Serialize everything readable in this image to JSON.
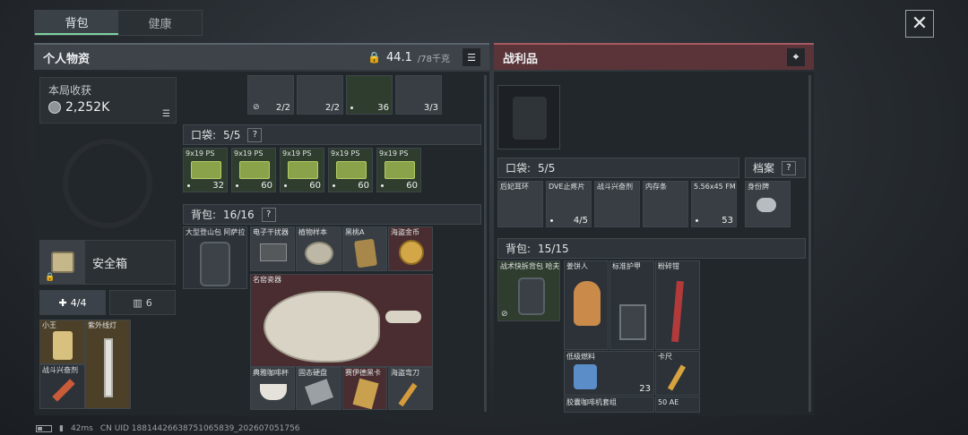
{
  "tabs": {
    "backpack": "背包",
    "health": "健康"
  },
  "left": {
    "title": "个人物资",
    "weight_current": "44.1",
    "weight_max": "/78千克"
  },
  "right": {
    "title": "战利品"
  },
  "harvest": {
    "label": "本局收获",
    "value": "2,252K"
  },
  "safe": {
    "label": "安全箱"
  },
  "subtabs": {
    "a": "4/4",
    "b": "6"
  },
  "pocket_left": {
    "label": "口袋:",
    "count": "5/5"
  },
  "backpack_left": {
    "label": "背包:",
    "count": "16/16"
  },
  "pocket_right": {
    "label": "口袋:",
    "count": "5/5"
  },
  "backpack_right": {
    "label": "背包:",
    "count": "15/15"
  },
  "archive": {
    "label": "档案"
  },
  "top_items": [
    {
      "count": "2/2"
    },
    {
      "count": "2/2"
    },
    {
      "count": "36"
    },
    {
      "count": "3/3"
    }
  ],
  "pocket_items_left": [
    {
      "name": "9x19 PS",
      "count": "32"
    },
    {
      "name": "9x19 PS",
      "count": "60"
    },
    {
      "name": "9x19 PS",
      "count": "60"
    },
    {
      "name": "9x19 PS",
      "count": "60"
    },
    {
      "name": "9x19 PS",
      "count": "60"
    }
  ],
  "backpack_items_left": {
    "bag": "大型登山包 阿萨拉",
    "jammer": "电子干扰器",
    "plant": "植物样本",
    "peach": "黑桃A",
    "coin": "海盗金币",
    "porcelain": "名窑瓷器",
    "cup": "典雅咖啡杯",
    "ssd": "固态硬盘",
    "card": "赛伊德黑卡",
    "knife": "海盗弯刀"
  },
  "safe_items": {
    "king": "小王",
    "uv": "紫外线灯",
    "stim": "战斗兴奋剂"
  },
  "pocket_items_right": [
    {
      "name": "后妃耳环",
      "count": ""
    },
    {
      "name": "DVE止疼片",
      "count": "4/5"
    },
    {
      "name": "战斗兴奋剂",
      "count": ""
    },
    {
      "name": "内存条",
      "count": ""
    },
    {
      "name": "5.56x45 FM",
      "count": "53"
    }
  ],
  "id_tag": {
    "name": "身份牌"
  },
  "backpack_items_right": {
    "tactical_bag": "战术快拆背包 哈夫克",
    "gingerbread": "姜饼人",
    "armor": "标准护甲",
    "crusher": "粉碎钳",
    "fuel": "低级燃料",
    "fuel_count": "23",
    "ruler": "卡尺",
    "coffee": "胶囊咖啡机套组",
    "ammo": "50 AE"
  },
  "status": {
    "ping": "42ms",
    "uid": "CN UID 18814426638751065839_202607051756"
  }
}
